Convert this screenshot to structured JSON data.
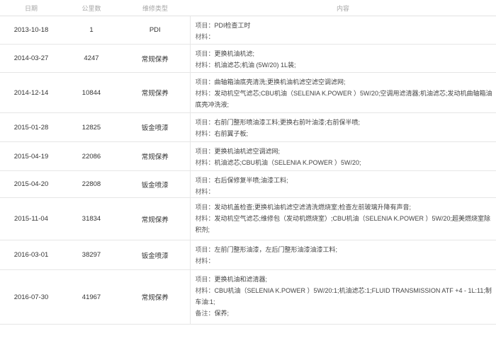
{
  "headers": [
    "日期",
    "公里数",
    "维修类型",
    "内容"
  ],
  "labels": {
    "item": "项目：",
    "material": "材料：",
    "note": "备注："
  },
  "rows": [
    {
      "date": "2013-10-18",
      "km": "1",
      "type": "PDI",
      "item": "PDI检查工时",
      "material": ""
    },
    {
      "date": "2014-03-27",
      "km": "4247",
      "type": "常规保养",
      "item": "更换机油机滤;",
      "material": "机油滤芯;机油 (5W/20) 1L装;"
    },
    {
      "date": "2014-12-14",
      "km": "10844",
      "type": "常规保养",
      "item": "曲轴箱油底壳清洗;更换机油机滤空滤空调滤网;",
      "material": "发动机空气滤芯;CBU机油（SELENIA K.POWER ）5W/20;空调用滤清器;机油滤芯;发动机曲轴箱油底壳冲洗液;"
    },
    {
      "date": "2015-01-28",
      "km": "12825",
      "type": "钣金喷漆",
      "item": "右前门整形喷油漆工料;更换右前叶油漆;右前保半喷;",
      "material": "右前翼子板;"
    },
    {
      "date": "2015-04-19",
      "km": "22086",
      "type": "常规保养",
      "item": "更换机油机滤空调滤网;",
      "material": "机油滤芯;CBU机油（SELENIA K.POWER ）5W/20;"
    },
    {
      "date": "2015-04-20",
      "km": "22808",
      "type": "钣金喷漆",
      "item": "右后保修复半喷;油漆工料;",
      "material": ""
    },
    {
      "date": "2015-11-04",
      "km": "31834",
      "type": "常规保养",
      "item": "发动机盖检查;更换机油机滤空滤清洗燃烧室;检查左前玻璃升降有声音;",
      "material": "发动机空气滤芯;维修包（发动机燃烧室）;CBU机油（SELENIA K.POWER ）5W/20;超美燃烧室除积剂;"
    },
    {
      "date": "2016-03-01",
      "km": "38297",
      "type": "钣金喷漆",
      "item": "左前门整形油漆，左后门整形油漆油漆工料;",
      "material": ""
    },
    {
      "date": "2016-07-30",
      "km": "41967",
      "type": "常规保养",
      "item": "更换机油和滤清器;",
      "material": "CBU机油（SELENIA K.POWER ）5W/20:1;机油滤芯:1;FLUID TRANSMISSION ATF +4 - 1L:11;制车油:1;",
      "note": "保养;"
    }
  ]
}
